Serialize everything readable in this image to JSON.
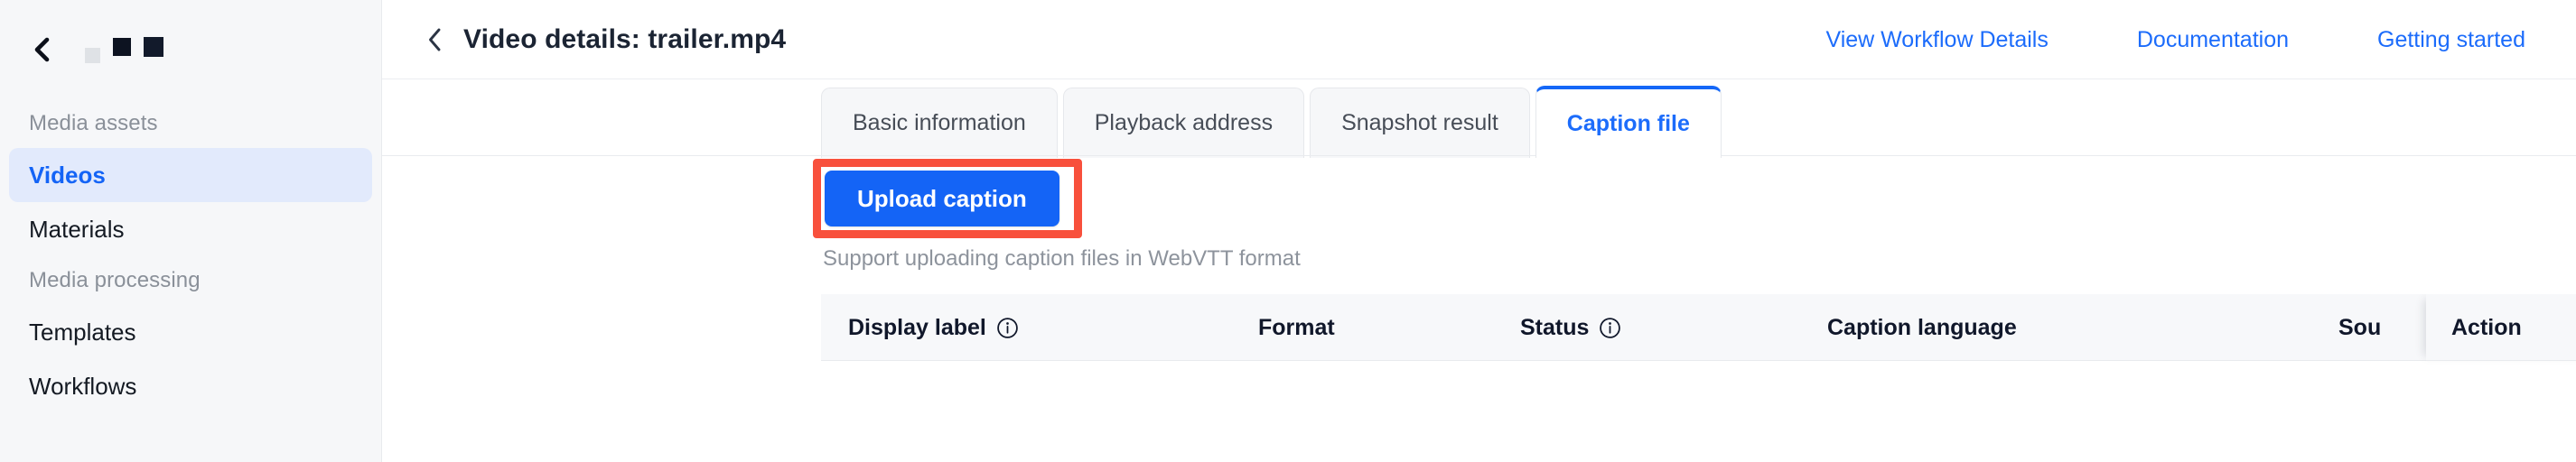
{
  "sidebar": {
    "collapse_icon": "chevron-left-icon",
    "logo_squares": [
      "pale",
      "dark",
      "dark"
    ],
    "groups": [
      {
        "title": "Media assets",
        "items": [
          {
            "label": "Videos",
            "active": true
          },
          {
            "label": "Materials",
            "active": false
          }
        ]
      },
      {
        "title": "Media processing",
        "items": [
          {
            "label": "Templates",
            "active": false
          },
          {
            "label": "Workflows",
            "active": false
          }
        ]
      }
    ]
  },
  "header": {
    "back_icon": "chevron-left-icon",
    "title": "Video details: trailer.mp4",
    "links": [
      {
        "label": "View Workflow Details"
      },
      {
        "label": "Documentation"
      },
      {
        "label": "Getting started"
      }
    ]
  },
  "tabs": [
    {
      "label": "Basic information",
      "active": false
    },
    {
      "label": "Playback address",
      "active": false
    },
    {
      "label": "Snapshot result",
      "active": false
    },
    {
      "label": "Caption file",
      "active": true
    }
  ],
  "caption_panel": {
    "upload_button_label": "Upload caption",
    "support_text": "Support uploading caption files in WebVTT format",
    "highlight_color": "#f8503c",
    "primary_color": "#1464f6"
  },
  "table": {
    "columns": [
      {
        "key": "display_label",
        "label": "Display label",
        "info": true
      },
      {
        "key": "format",
        "label": "Format",
        "info": false
      },
      {
        "key": "status",
        "label": "Status",
        "info": true
      },
      {
        "key": "caption_language",
        "label": "Caption language",
        "info": false
      },
      {
        "key": "source",
        "label": "Sou",
        "info": false
      }
    ],
    "sticky_column": {
      "key": "action",
      "label": "Action"
    },
    "rows": []
  }
}
